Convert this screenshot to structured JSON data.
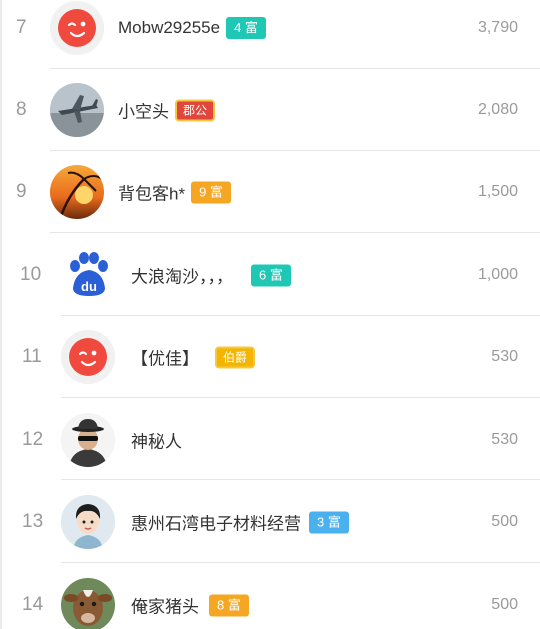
{
  "list": {
    "rows": [
      {
        "rank": "7",
        "name": "Mobw29255e",
        "badge": "4 富",
        "badge_type": "teal",
        "score": "3,790",
        "avatar": "red-face-icon"
      },
      {
        "rank": "8",
        "name": "小空头",
        "badge": "郡公",
        "badge_type": "title",
        "score": "2,080",
        "avatar": "airplane-photo"
      },
      {
        "rank": "9",
        "name": "背包客h*",
        "badge": "9 富",
        "badge_type": "orange",
        "score": "1,500",
        "avatar": "sunset-palm-photo"
      },
      {
        "rank": "10",
        "name": "大浪淘沙，，，",
        "badge": "6 富",
        "badge_type": "teal",
        "score": "1,000",
        "avatar": "baidu-paw-icon"
      },
      {
        "rank": "11",
        "name": "【优佳】",
        "badge": "伯爵",
        "badge_type": "title-gold",
        "score": "530",
        "avatar": "red-face-icon"
      },
      {
        "rank": "12",
        "name": "神秘人",
        "badge": "",
        "badge_type": "",
        "score": "530",
        "avatar": "mystery-man-icon"
      },
      {
        "rank": "13",
        "name": "惠州石湾电子材料经营",
        "badge": "3 富",
        "badge_type": "blue",
        "score": "500",
        "avatar": "cartoon-person-avatar"
      },
      {
        "rank": "14",
        "name": "俺家猪头",
        "badge": "8 富",
        "badge_type": "orange",
        "score": "500",
        "avatar": "calf-photo"
      }
    ]
  },
  "colors": {
    "teal": "#1ec8b4",
    "orange": "#f5a623",
    "blue": "#4ab0ee",
    "title_red": "#e0463c",
    "title_gold": "#f5b400",
    "rank_gray": "#9a9a9a"
  }
}
